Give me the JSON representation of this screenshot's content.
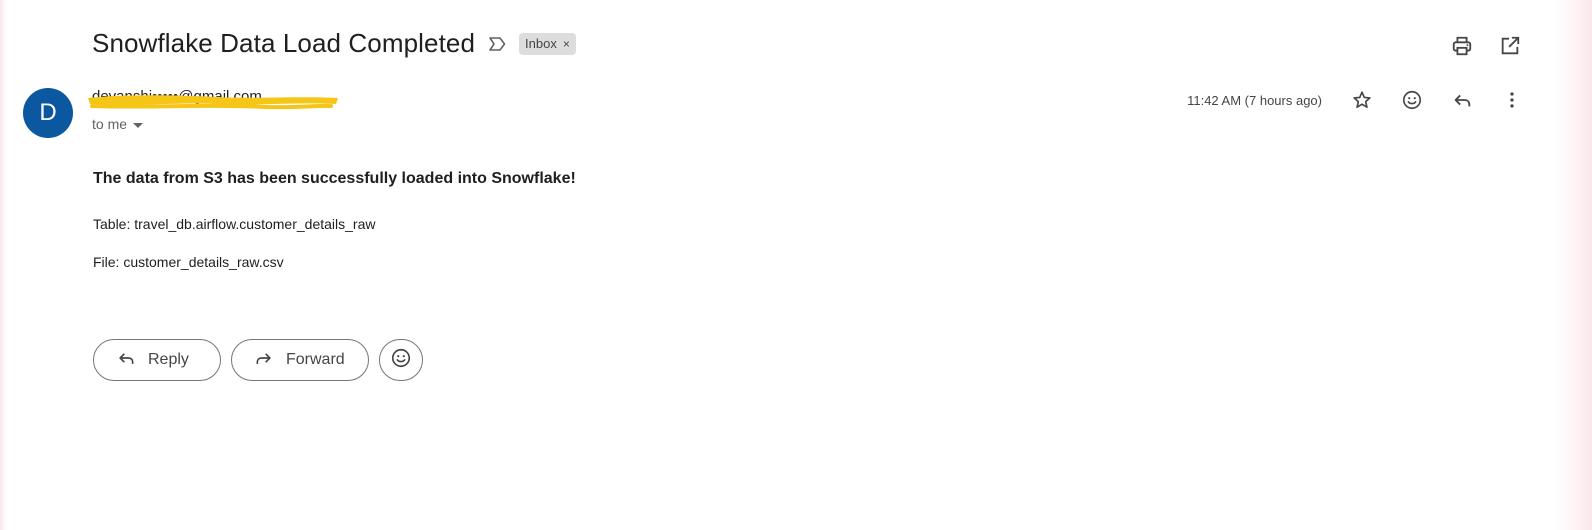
{
  "subject": {
    "title": "Snowflake Data Load Completed",
    "label": "Inbox",
    "label_remove": "×"
  },
  "sender": {
    "avatar_initial": "D",
    "avatar_color": "#0b57a0",
    "name_redacted": "devanshi•••••@gmail.com",
    "redaction_color": "#f5c518",
    "recipient": "to me",
    "timestamp": "11:42 AM (7 hours ago)"
  },
  "body": {
    "headline": "The data from S3 has been successfully loaded into Snowflake!",
    "table_line": "Table: travel_db.airflow.customer_details_raw",
    "file_line": "File: customer_details_raw.csv"
  },
  "actions": {
    "reply_label": "Reply",
    "forward_label": "Forward"
  },
  "icons": {
    "importance": "importance-marker-icon",
    "print": "print-icon",
    "open_new_window": "open-in-new-window-icon",
    "star": "star-icon",
    "emoji": "add-reaction-icon",
    "reply": "reply-icon",
    "more": "more-vert-icon",
    "forward": "forward-icon"
  }
}
